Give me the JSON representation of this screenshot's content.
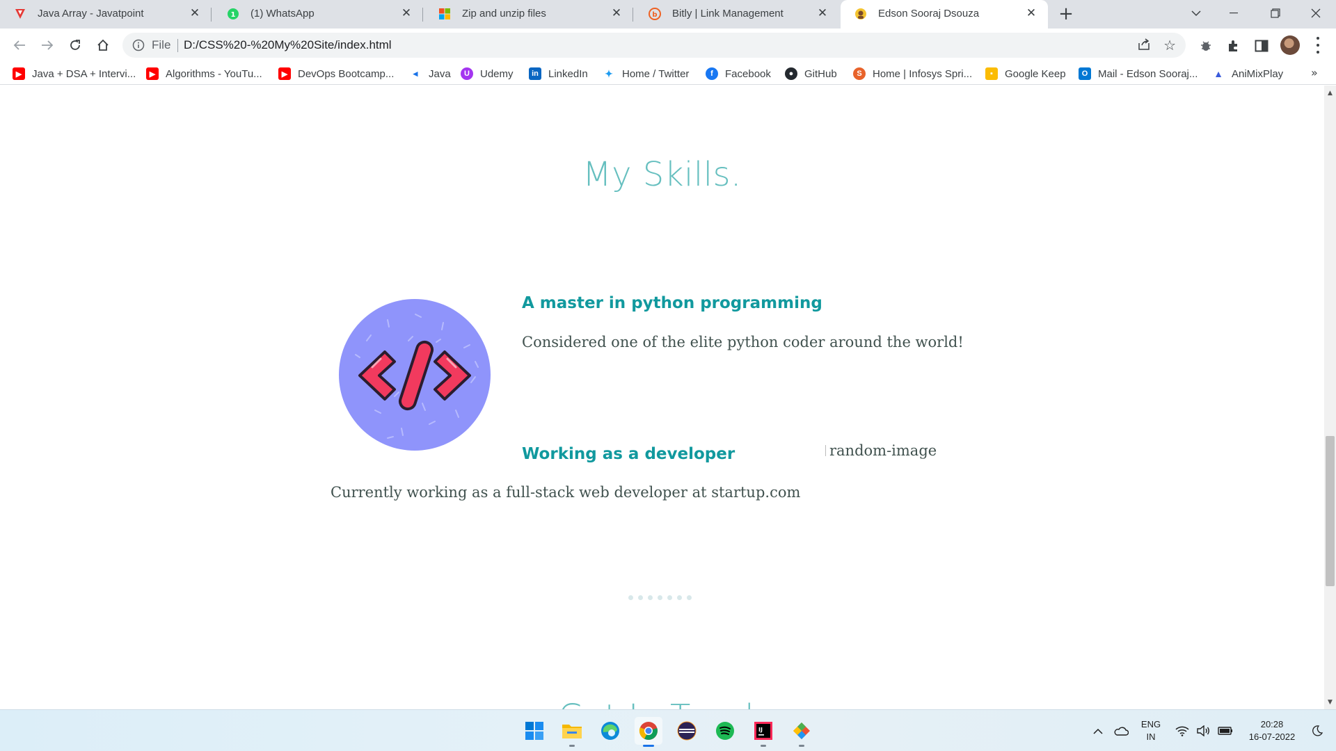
{
  "browser": {
    "tabs": [
      {
        "title": "Java Array - Javatpoint",
        "icon": "javatpoint-icon",
        "active": false
      },
      {
        "title": "(1) WhatsApp",
        "icon": "whatsapp-icon",
        "active": false
      },
      {
        "title": "Zip and unzip files",
        "icon": "microsoft-icon",
        "active": false
      },
      {
        "title": "Bitly | Link Management",
        "icon": "bitly-icon",
        "active": false
      },
      {
        "title": "Edson Sooraj Dsouza",
        "icon": "site-favicon-icon",
        "active": true
      }
    ],
    "address": {
      "scheme_label": "File",
      "url": "D:/CSS%20-%20My%20Site/index.html"
    },
    "bookmarks": [
      {
        "label": "Java + DSA + Intervi...",
        "icon": "youtube-icon"
      },
      {
        "label": "Algorithms - YouTu...",
        "icon": "youtube-icon"
      },
      {
        "label": "DevOps Bootcamp...",
        "icon": "youtube-icon"
      },
      {
        "label": "Java",
        "icon": "java-icon"
      },
      {
        "label": "Udemy",
        "icon": "udemy-icon"
      },
      {
        "label": "LinkedIn",
        "icon": "linkedin-icon"
      },
      {
        "label": "Home / Twitter",
        "icon": "twitter-icon"
      },
      {
        "label": "Facebook",
        "icon": "facebook-icon"
      },
      {
        "label": "GitHub",
        "icon": "github-icon"
      },
      {
        "label": "Home | Infosys Spri...",
        "icon": "infosys-icon"
      },
      {
        "label": "Google Keep",
        "icon": "google-keep-icon"
      },
      {
        "label": "Mail - Edson Sooraj...",
        "icon": "outlook-icon"
      },
      {
        "label": "AniMixPlay",
        "icon": "animixplay-icon"
      }
    ],
    "bookmarks_overflow": "»"
  },
  "page": {
    "section_title": "My Skills.",
    "skills": [
      {
        "heading": "A master in python programming",
        "description": "Considered one of the elite python coder around the world!"
      },
      {
        "heading": "Working as a developer",
        "description": "Currently working as a full-stack web developer at startup.com",
        "image_alt": "random-image"
      }
    ],
    "next_section_title": "Get In Touch"
  },
  "taskbar": {
    "apps": [
      "windows-start-icon",
      "file-explorer-icon",
      "edge-icon",
      "chrome-icon",
      "eclipse-icon",
      "spotify-icon",
      "intellij-icon",
      "git-icon"
    ],
    "language": {
      "line1": "ENG",
      "line2": "IN"
    },
    "time": "20:28",
    "date": "16-07-2022"
  },
  "colors": {
    "title_teal": "#66bfbf",
    "heading_teal": "#11999e",
    "body_text": "#40514e",
    "icon_circle": "#8f94fb",
    "icon_code": "#f23a5e"
  }
}
